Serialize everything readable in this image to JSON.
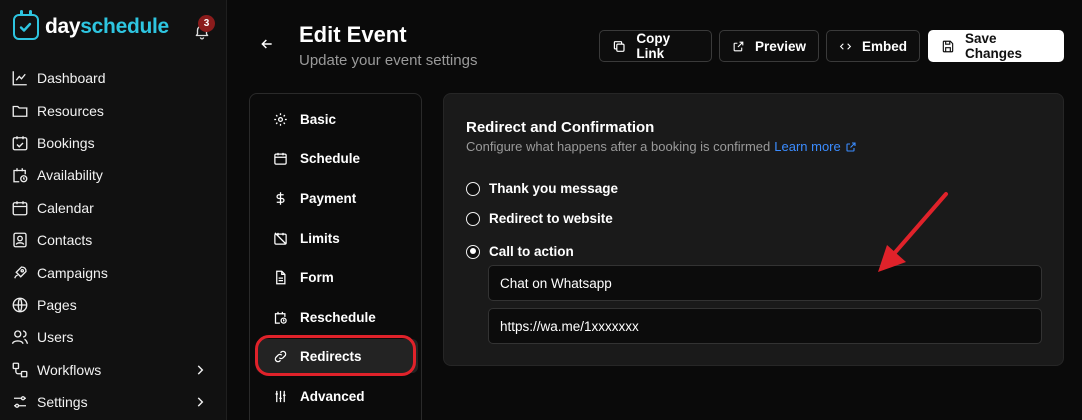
{
  "brand": {
    "name_part1": "day",
    "name_part2": "schedule",
    "notification_count": "3"
  },
  "sidebar": {
    "items": [
      {
        "label": "Dashboard",
        "icon": "chart-line-icon"
      },
      {
        "label": "Resources",
        "icon": "folder-icon"
      },
      {
        "label": "Bookings",
        "icon": "calendar-check-icon"
      },
      {
        "label": "Availability",
        "icon": "calendar-clock-icon"
      },
      {
        "label": "Calendar",
        "icon": "calendar-icon"
      },
      {
        "label": "Contacts",
        "icon": "contact-card-icon"
      },
      {
        "label": "Campaigns",
        "icon": "rocket-icon"
      },
      {
        "label": "Pages",
        "icon": "globe-icon"
      },
      {
        "label": "Users",
        "icon": "users-icon"
      },
      {
        "label": "Workflows",
        "icon": "workflow-icon"
      },
      {
        "label": "Settings",
        "icon": "sliders-icon"
      }
    ]
  },
  "header": {
    "title": "Edit Event",
    "subtitle": "Update your event settings",
    "copy_link_label": "Copy Link",
    "preview_label": "Preview",
    "embed_label": "Embed",
    "save_label": "Save Changes"
  },
  "menu": {
    "items": [
      {
        "label": "Basic",
        "icon": "gear-icon"
      },
      {
        "label": "Schedule",
        "icon": "calendar-icon"
      },
      {
        "label": "Payment",
        "icon": "dollar-icon"
      },
      {
        "label": "Limits",
        "icon": "calendar-off-icon"
      },
      {
        "label": "Form",
        "icon": "document-icon"
      },
      {
        "label": "Reschedule",
        "icon": "calendar-clock-icon"
      },
      {
        "label": "Redirects",
        "icon": "link-icon"
      },
      {
        "label": "Advanced",
        "icon": "sliders-icon"
      }
    ],
    "active": "Redirects"
  },
  "redirects": {
    "title": "Redirect and Confirmation",
    "description": "Configure what happens after a booking is confirmed",
    "learn_more": "Learn more",
    "options": [
      {
        "label": "Thank you message",
        "selected": false
      },
      {
        "label": "Redirect to website",
        "selected": false
      },
      {
        "label": "Call to action",
        "selected": true
      }
    ],
    "cta_text": "Chat on Whatsapp",
    "cta_url": "https://wa.me/1xxxxxxx"
  },
  "colors": {
    "accent": "#2ec5e0",
    "link": "#3b8cff",
    "annotation": "#e0222a",
    "badge": "#8b1c1c"
  }
}
